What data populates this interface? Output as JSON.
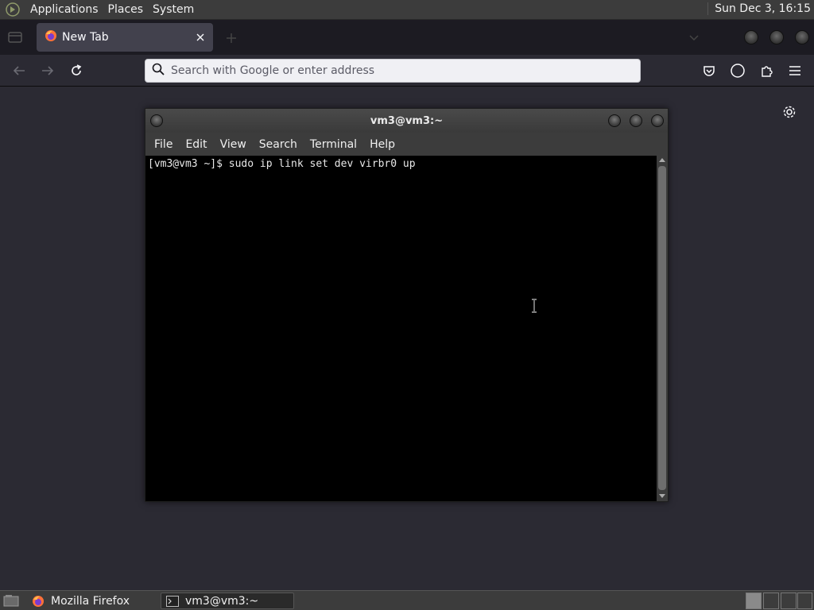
{
  "top_panel": {
    "menus": [
      "Applications",
      "Places",
      "System"
    ],
    "clock": "Sun Dec  3, 16:15"
  },
  "browser": {
    "tab_title": "New Tab",
    "url_placeholder": "Search with Google or enter address"
  },
  "terminal": {
    "title": "vm3@vm3:~",
    "menus": [
      "File",
      "Edit",
      "View",
      "Search",
      "Terminal",
      "Help"
    ],
    "lines": [
      "[vm3@vm3 ~]$ sudo ip link set dev virbr0 up"
    ]
  },
  "taskbar": {
    "tasks": [
      "Mozilla Firefox",
      "vm3@vm3:~"
    ]
  },
  "colors": {
    "panel": "#3c3c3c",
    "browser_chrome": "#1c1b22",
    "browser_content": "#2b2a33",
    "terminal_bg": "#000000",
    "firefox_orange": "#ff7139"
  }
}
